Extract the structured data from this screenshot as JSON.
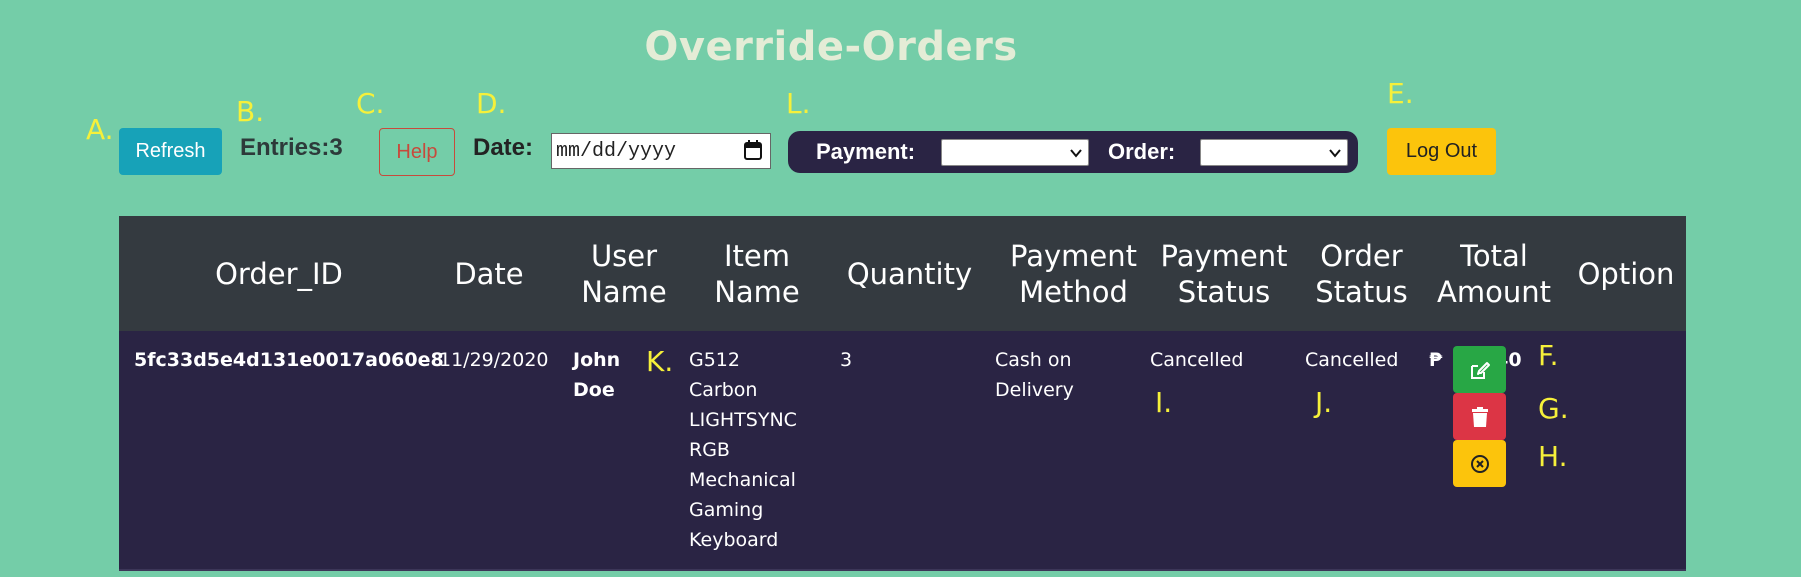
{
  "page": {
    "title": "Override-Orders"
  },
  "markers": {
    "a": "A.",
    "b": "B.",
    "c": "C.",
    "d": "D.",
    "e": "E.",
    "l": "L.",
    "f": "F.",
    "g": "G.",
    "h": "H.",
    "i": "I.",
    "j": "J.",
    "k": "K."
  },
  "toolbar": {
    "refresh_label": "Refresh",
    "entries_text": "Entries:3",
    "help_label": "Help",
    "date_label": "Date:",
    "date_placeholder": "mm/dd/yyyy",
    "payment_label": "Payment:",
    "payment_selected": "",
    "order_label": "Order:",
    "order_selected": "",
    "logout_label": "Log Out"
  },
  "table": {
    "headers": [
      "Order_ID",
      "Date",
      "User\nName",
      "Item\nName",
      "Quantity",
      "Payment\nMethod",
      "Payment\nStatus",
      "Order\nStatus",
      "Total\nAmount",
      "Option"
    ],
    "rows": [
      {
        "order_id": "5fc33d5e4d131e0017a060e8",
        "date": "11/29/2020",
        "user_name_line1": "John",
        "user_name_line2": "Doe",
        "item_name_lines": [
          "G512",
          "Carbon",
          "LIGHTSYNC",
          "RGB",
          "Mechanical",
          "Gaming",
          "Keyboard"
        ],
        "quantity": "3",
        "payment_method_line1": "Cash on",
        "payment_method_line2": "Delivery",
        "payment_status": "Cancelled",
        "order_status": "Cancelled",
        "currency_symbol": "₱",
        "total_amount": "15640"
      }
    ]
  },
  "colors": {
    "background": "#74cda8",
    "header_bg": "#343a40",
    "row_bg": "#2a2444",
    "refresh": "#17a2b8",
    "logout": "#fcc40c",
    "edit": "#28a745",
    "delete": "#dc3545",
    "cancel": "#fcc40c",
    "marker": "#f6f03a"
  },
  "icons": {
    "edit": "edit-icon",
    "delete": "trash-icon",
    "cancel": "cancel-circle-icon",
    "calendar": "calendar-icon",
    "dropdown": "chevron-down-icon"
  }
}
